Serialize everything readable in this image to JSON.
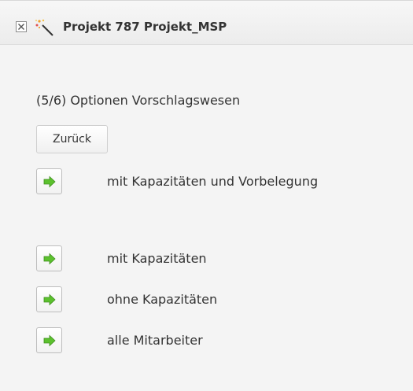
{
  "header": {
    "title": "Projekt 787 Projekt_MSP",
    "close_icon": "close-icon",
    "wand_icon": "magic-wand-icon"
  },
  "main": {
    "subtitle": "(5/6) Optionen Vorschlagswesen",
    "back_label": "Zurück",
    "options": [
      {
        "label": "mit Kapazitäten und Vorbelegung",
        "icon": "arrow-right-icon"
      },
      {
        "label": "mit Kapazitäten",
        "icon": "arrow-right-icon"
      },
      {
        "label": "ohne Kapazitäten",
        "icon": "arrow-right-icon"
      },
      {
        "label": "alle Mitarbeiter",
        "icon": "arrow-right-icon"
      }
    ]
  },
  "colors": {
    "arrow_green": "#5cc12e",
    "text": "#333333",
    "background": "#f4f4f4"
  }
}
